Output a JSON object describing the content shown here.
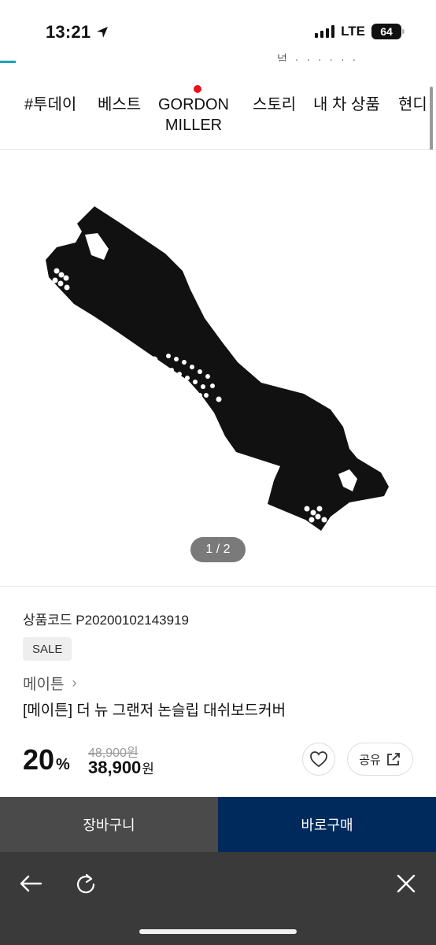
{
  "status_bar": {
    "time": "13:21",
    "network": "LTE",
    "battery": "64"
  },
  "header": {
    "cut_text": "넘 ·  ·  ·  ·  ·  ·"
  },
  "categories": [
    {
      "label": "#투데이"
    },
    {
      "label": "베스트"
    },
    {
      "label": "GORDON",
      "label2": "MILLER",
      "badge": "new-dot"
    },
    {
      "label": "스토리"
    },
    {
      "label": "내 차 상품"
    },
    {
      "label": "현디"
    }
  ],
  "product": {
    "image_counter": "1 / 2",
    "code_label": "상품코드 P20200102143919",
    "badge": "SALE",
    "brand": "메이튼",
    "name": "[메이튼] 더 뉴 그랜저 논슬립 대쉬보드커버",
    "discount": "20",
    "discount_unit": "%",
    "original_price": "48,900원",
    "sale_price": "38,900",
    "sale_price_unit": "원",
    "share_label": "공유"
  },
  "actions": {
    "cart": "장바구니",
    "buy": "바로구매"
  },
  "colors": {
    "accent": "#19a3c2",
    "buy_button": "#002a5c",
    "cart_button": "#4a4a4a",
    "new_dot": "#e8141d",
    "toolbar": "#3a3a3a"
  },
  "icons": {
    "location": "location-arrow-icon",
    "like": "heart-icon",
    "share": "share-icon",
    "back": "back-arrow-icon",
    "reload": "reload-icon",
    "close": "close-icon"
  }
}
